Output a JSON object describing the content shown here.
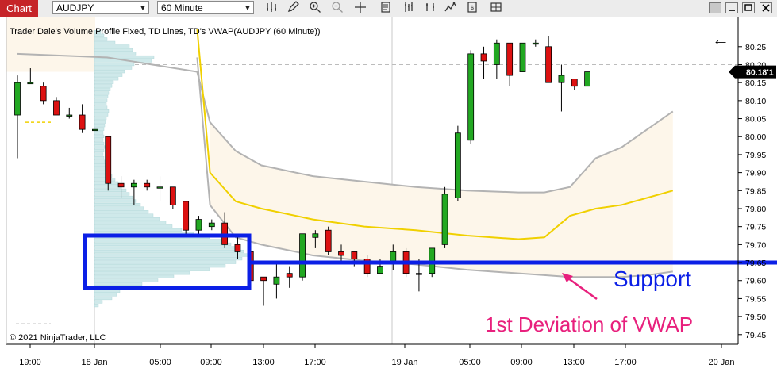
{
  "toolbar": {
    "chart_tab": "Chart",
    "instrument": "AUDJPY",
    "interval": "60 Minute",
    "dropdown_arrow": "▼",
    "icons": [
      "bar-chart-icon",
      "pencil-icon",
      "zoom-in-icon",
      "zoom-out-icon",
      "crosshair-icon",
      "properties-icon",
      "indicators-icon",
      "strategies-icon",
      "data-box-icon",
      "chart-trader-icon",
      "minimize-icon",
      "maximize-icon",
      "close-icon"
    ]
  },
  "colors": {
    "up_candle": "#22a822",
    "down_candle": "#dd1111",
    "support_box": "#0b1fe6",
    "support_line": "#0b1fe6",
    "vwap": "#f0d000",
    "deviation": "#b3b3b3",
    "deviation_fill": "#fdf6ea",
    "volume_profile": "#cfe9ea",
    "annotation_pink": "#e8207d",
    "price_marker_bg": "#000000"
  },
  "chart_data": {
    "type": "candlestick",
    "title": "Trader Dale's Volume Profile Fixed, TD Lines, TD's VWAP(AUDJPY (60 Minute))",
    "copyright": "© 2021 NinjaTrader, LLC",
    "instrument": "AUDJPY",
    "timeframe": "60 Minute",
    "ylim": [
      79.42,
      80.32
    ],
    "y_ticks": [
      "80.25",
      "80.20",
      "80.15",
      "80.10",
      "80.05",
      "80.00",
      "79.95",
      "79.90",
      "79.85",
      "79.80",
      "79.75",
      "79.70",
      "79.65",
      "79.60",
      "79.55",
      "79.50",
      "79.45"
    ],
    "x_ticks": [
      "19:00",
      "18 Jan",
      "05:00",
      "09:00",
      "13:00",
      "17:00",
      "19 Jan",
      "05:00",
      "09:00",
      "13:00",
      "17:00",
      "20 Jan"
    ],
    "current_price": "80.18'1",
    "support_level": 79.65,
    "support_label": "Support",
    "deviation_label": "1st Deviation of VWAP",
    "candles": [
      {
        "o": 80.06,
        "h": 80.17,
        "l": 79.94,
        "c": 80.15
      },
      {
        "o": 80.15,
        "h": 80.19,
        "l": 80.15,
        "c": 80.15
      },
      {
        "o": 80.14,
        "h": 80.15,
        "l": 80.09,
        "c": 80.1
      },
      {
        "o": 80.1,
        "h": 80.11,
        "l": 80.06,
        "c": 80.06
      },
      {
        "o": 80.06,
        "h": 80.08,
        "l": 80.05,
        "c": 80.06
      },
      {
        "o": 80.06,
        "h": 80.09,
        "l": 80.01,
        "c": 80.02
      },
      {
        "o": 80.02,
        "h": 80.02,
        "l": 80.02,
        "c": 80.02
      },
      {
        "o": 80.0,
        "h": 80.0,
        "l": 79.85,
        "c": 79.87
      },
      {
        "o": 79.87,
        "h": 79.89,
        "l": 79.83,
        "c": 79.86
      },
      {
        "o": 79.86,
        "h": 79.88,
        "l": 79.81,
        "c": 79.87
      },
      {
        "o": 79.87,
        "h": 79.88,
        "l": 79.85,
        "c": 79.86
      },
      {
        "o": 79.86,
        "h": 79.89,
        "l": 79.82,
        "c": 79.86
      },
      {
        "o": 79.86,
        "h": 79.86,
        "l": 79.8,
        "c": 79.81
      },
      {
        "o": 79.82,
        "h": 79.82,
        "l": 79.73,
        "c": 79.74
      },
      {
        "o": 79.74,
        "h": 79.78,
        "l": 79.73,
        "c": 79.77
      },
      {
        "o": 79.75,
        "h": 79.77,
        "l": 79.74,
        "c": 79.76
      },
      {
        "o": 79.76,
        "h": 79.79,
        "l": 79.69,
        "c": 79.7
      },
      {
        "o": 79.7,
        "h": 79.72,
        "l": 79.66,
        "c": 79.68
      },
      {
        "o": 79.68,
        "h": 79.69,
        "l": 79.59,
        "c": 79.6
      },
      {
        "o": 79.61,
        "h": 79.61,
        "l": 79.53,
        "c": 79.6
      },
      {
        "o": 79.59,
        "h": 79.65,
        "l": 79.55,
        "c": 79.61
      },
      {
        "o": 79.62,
        "h": 79.64,
        "l": 79.58,
        "c": 79.61
      },
      {
        "o": 79.61,
        "h": 79.68,
        "l": 79.6,
        "c": 79.73
      },
      {
        "o": 79.72,
        "h": 79.74,
        "l": 79.69,
        "c": 79.73
      },
      {
        "o": 79.74,
        "h": 79.75,
        "l": 79.67,
        "c": 79.68
      },
      {
        "o": 79.68,
        "h": 79.7,
        "l": 79.65,
        "c": 79.67
      },
      {
        "o": 79.68,
        "h": 79.68,
        "l": 79.64,
        "c": 79.66
      },
      {
        "o": 79.66,
        "h": 79.67,
        "l": 79.61,
        "c": 79.62
      },
      {
        "o": 79.62,
        "h": 79.66,
        "l": 79.62,
        "c": 79.64
      },
      {
        "o": 79.65,
        "h": 79.7,
        "l": 79.63,
        "c": 79.68
      },
      {
        "o": 79.68,
        "h": 79.69,
        "l": 79.61,
        "c": 79.62
      },
      {
        "o": 79.62,
        "h": 79.66,
        "l": 79.57,
        "c": 79.62
      },
      {
        "o": 79.62,
        "h": 79.69,
        "l": 79.61,
        "c": 79.69
      },
      {
        "o": 79.7,
        "h": 79.86,
        "l": 79.69,
        "c": 79.84
      },
      {
        "o": 79.83,
        "h": 80.03,
        "l": 79.82,
        "c": 80.01
      },
      {
        "o": 79.99,
        "h": 80.24,
        "l": 79.98,
        "c": 80.23
      },
      {
        "o": 80.23,
        "h": 80.25,
        "l": 80.16,
        "c": 80.21
      },
      {
        "o": 80.2,
        "h": 80.27,
        "l": 80.16,
        "c": 80.26
      },
      {
        "o": 80.26,
        "h": 80.26,
        "l": 80.14,
        "c": 80.17
      },
      {
        "o": 80.18,
        "h": 80.26,
        "l": 80.18,
        "c": 80.26
      },
      {
        "o": 80.26,
        "h": 80.27,
        "l": 80.25,
        "c": 80.26
      },
      {
        "o": 80.25,
        "h": 80.28,
        "l": 80.15,
        "c": 80.15
      },
      {
        "o": 80.15,
        "h": 80.2,
        "l": 80.07,
        "c": 80.17
      },
      {
        "o": 80.16,
        "h": 80.16,
        "l": 80.13,
        "c": 80.14
      },
      {
        "o": 80.14,
        "h": 80.18,
        "l": 80.14,
        "c": 80.18
      }
    ],
    "vwap": [
      {
        "i": 7,
        "v": 80.3
      },
      {
        "i": 8,
        "v": 79.9
      },
      {
        "i": 10,
        "v": 79.82
      },
      {
        "i": 12,
        "v": 79.8
      },
      {
        "i": 16,
        "v": 79.77
      },
      {
        "i": 20,
        "v": 79.75
      },
      {
        "i": 24,
        "v": 79.74
      },
      {
        "i": 28,
        "v": 79.725
      },
      {
        "i": 32,
        "v": 79.715
      },
      {
        "i": 34,
        "v": 79.72
      },
      {
        "i": 36,
        "v": 79.78
      },
      {
        "i": 38,
        "v": 79.8
      },
      {
        "i": 40,
        "v": 79.81
      },
      {
        "i": 42,
        "v": 79.83
      },
      {
        "i": 44,
        "v": 79.85
      }
    ],
    "upper_deviation": [
      {
        "i": -7,
        "v": 80.23
      },
      {
        "i": 0,
        "v": 80.22
      },
      {
        "i": 7,
        "v": 80.18
      },
      {
        "i": 8,
        "v": 80.04
      },
      {
        "i": 10,
        "v": 79.96
      },
      {
        "i": 12,
        "v": 79.92
      },
      {
        "i": 16,
        "v": 79.89
      },
      {
        "i": 20,
        "v": 79.875
      },
      {
        "i": 24,
        "v": 79.86
      },
      {
        "i": 28,
        "v": 79.85
      },
      {
        "i": 32,
        "v": 79.845
      },
      {
        "i": 34,
        "v": 79.845
      },
      {
        "i": 36,
        "v": 79.86
      },
      {
        "i": 38,
        "v": 79.94
      },
      {
        "i": 40,
        "v": 79.97
      },
      {
        "i": 42,
        "v": 80.02
      },
      {
        "i": 44,
        "v": 80.07
      }
    ],
    "lower_deviation": [
      {
        "i": 7,
        "v": 80.22
      },
      {
        "i": 8,
        "v": 79.81
      },
      {
        "i": 10,
        "v": 79.72
      },
      {
        "i": 12,
        "v": 79.7
      },
      {
        "i": 16,
        "v": 79.67
      },
      {
        "i": 20,
        "v": 79.655
      },
      {
        "i": 24,
        "v": 79.645
      },
      {
        "i": 28,
        "v": 79.63
      },
      {
        "i": 32,
        "v": 79.62
      },
      {
        "i": 34,
        "v": 79.615
      },
      {
        "i": 36,
        "v": 79.61
      },
      {
        "i": 38,
        "v": 79.61
      },
      {
        "i": 40,
        "v": 79.61
      },
      {
        "i": 42,
        "v": 79.615
      },
      {
        "i": 44,
        "v": 79.625
      }
    ],
    "volume_profile": [
      {
        "p": 80.29,
        "v": 8
      },
      {
        "p": 80.28,
        "v": 12
      },
      {
        "p": 80.27,
        "v": 16
      },
      {
        "p": 80.26,
        "v": 26
      },
      {
        "p": 80.25,
        "v": 44
      },
      {
        "p": 80.24,
        "v": 48
      },
      {
        "p": 80.23,
        "v": 52
      },
      {
        "p": 80.22,
        "v": 75
      },
      {
        "p": 80.21,
        "v": 72
      },
      {
        "p": 80.2,
        "v": 50
      },
      {
        "p": 80.19,
        "v": 47
      },
      {
        "p": 80.18,
        "v": 38
      },
      {
        "p": 80.17,
        "v": 35
      },
      {
        "p": 80.16,
        "v": 30
      },
      {
        "p": 80.15,
        "v": 24
      },
      {
        "p": 80.14,
        "v": 22
      },
      {
        "p": 80.13,
        "v": 20
      },
      {
        "p": 80.12,
        "v": 18
      },
      {
        "p": 80.11,
        "v": 17
      },
      {
        "p": 80.1,
        "v": 16
      },
      {
        "p": 80.09,
        "v": 15
      },
      {
        "p": 80.08,
        "v": 16
      },
      {
        "p": 80.07,
        "v": 18
      },
      {
        "p": 80.06,
        "v": 17
      },
      {
        "p": 80.05,
        "v": 15
      },
      {
        "p": 80.04,
        "v": 14
      },
      {
        "p": 80.03,
        "v": 13
      },
      {
        "p": 80.02,
        "v": 12
      },
      {
        "p": 80.01,
        "v": 11
      },
      {
        "p": 80.0,
        "v": 12
      },
      {
        "p": 79.99,
        "v": 11
      },
      {
        "p": 79.98,
        "v": 12
      },
      {
        "p": 79.97,
        "v": 13
      },
      {
        "p": 79.96,
        "v": 12
      },
      {
        "p": 79.95,
        "v": 11
      },
      {
        "p": 79.94,
        "v": 12
      },
      {
        "p": 79.93,
        "v": 13
      },
      {
        "p": 79.92,
        "v": 15
      },
      {
        "p": 79.91,
        "v": 17
      },
      {
        "p": 79.9,
        "v": 19
      },
      {
        "p": 79.89,
        "v": 22
      },
      {
        "p": 79.88,
        "v": 26
      },
      {
        "p": 79.87,
        "v": 30
      },
      {
        "p": 79.86,
        "v": 34
      },
      {
        "p": 79.85,
        "v": 40
      },
      {
        "p": 79.84,
        "v": 44
      },
      {
        "p": 79.83,
        "v": 48
      },
      {
        "p": 79.82,
        "v": 52
      },
      {
        "p": 79.81,
        "v": 58
      },
      {
        "p": 79.8,
        "v": 62
      },
      {
        "p": 79.79,
        "v": 68
      },
      {
        "p": 79.78,
        "v": 74
      },
      {
        "p": 79.77,
        "v": 82
      },
      {
        "p": 79.76,
        "v": 90
      },
      {
        "p": 79.75,
        "v": 98
      },
      {
        "p": 79.74,
        "v": 110
      },
      {
        "p": 79.73,
        "v": 125
      },
      {
        "p": 79.72,
        "v": 145
      },
      {
        "p": 79.71,
        "v": 160
      },
      {
        "p": 79.7,
        "v": 172
      },
      {
        "p": 79.69,
        "v": 180
      },
      {
        "p": 79.68,
        "v": 188
      },
      {
        "p": 79.67,
        "v": 193
      },
      {
        "p": 79.66,
        "v": 186
      },
      {
        "p": 79.65,
        "v": 178
      },
      {
        "p": 79.64,
        "v": 165
      },
      {
        "p": 79.63,
        "v": 145
      },
      {
        "p": 79.62,
        "v": 120
      },
      {
        "p": 79.61,
        "v": 100
      },
      {
        "p": 79.6,
        "v": 80
      },
      {
        "p": 79.59,
        "v": 60
      },
      {
        "p": 79.58,
        "v": 40
      },
      {
        "p": 79.57,
        "v": 32
      },
      {
        "p": 79.56,
        "v": 28
      },
      {
        "p": 79.55,
        "v": 22
      },
      {
        "p": 79.54,
        "v": 10
      },
      {
        "p": 79.53,
        "v": 5
      }
    ],
    "left_support_dash": 80.04,
    "left_bottom_dash": 79.48,
    "top_dash": 80.2,
    "price_arrow": "←"
  }
}
